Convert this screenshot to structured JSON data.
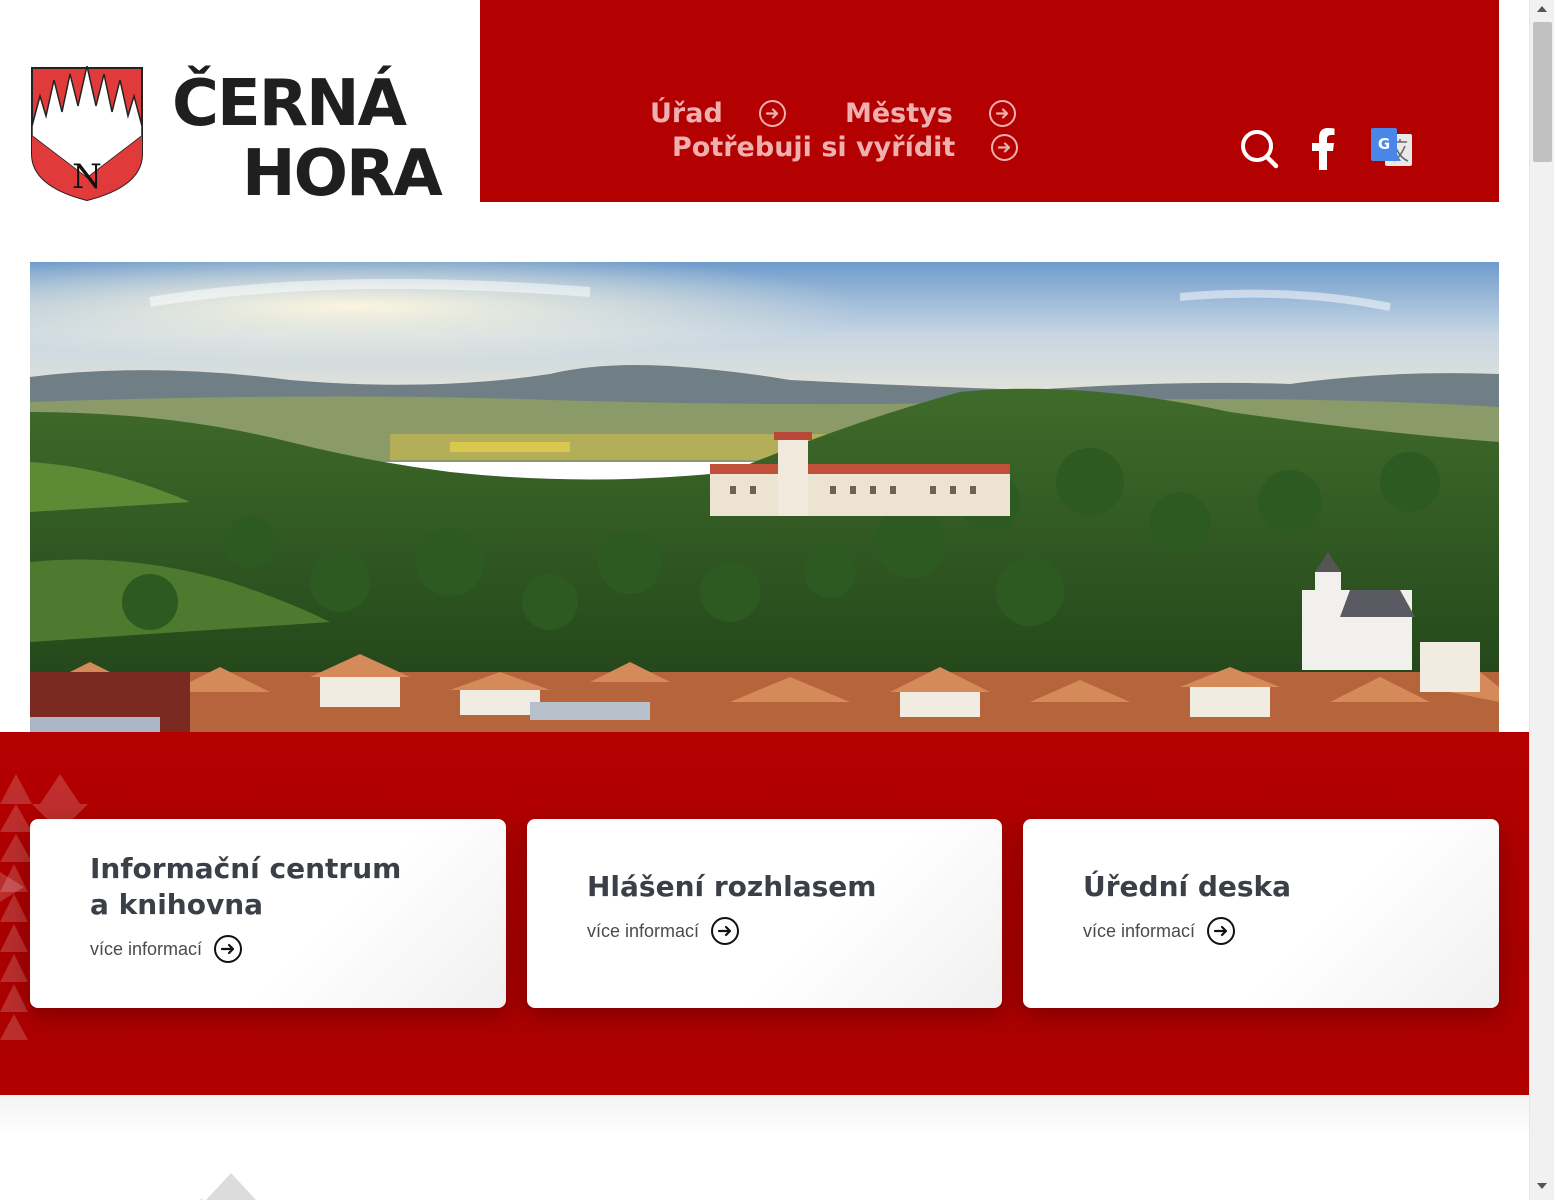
{
  "site": {
    "name_line1": "ČERNÁ",
    "name_line2": "HORA",
    "crest_letter": "N"
  },
  "nav": {
    "items": [
      {
        "label": "Úřad"
      },
      {
        "label": "Městys"
      },
      {
        "label": "Potřebuji si vyřídit"
      }
    ]
  },
  "header_icons": [
    "search-icon",
    "facebook-icon",
    "google-translate-icon"
  ],
  "cards": [
    {
      "title_line1": "Informační centrum",
      "title_line2": "a knihovna",
      "link": "více informací"
    },
    {
      "title": "Hlášení rozhlasem",
      "link": "více informací"
    },
    {
      "title": "Úřední deska",
      "link": "více informací"
    }
  ],
  "colors": {
    "brand_red": "#b30000",
    "nav_text": "#f0b0b0",
    "card_title": "#3b3f48"
  }
}
